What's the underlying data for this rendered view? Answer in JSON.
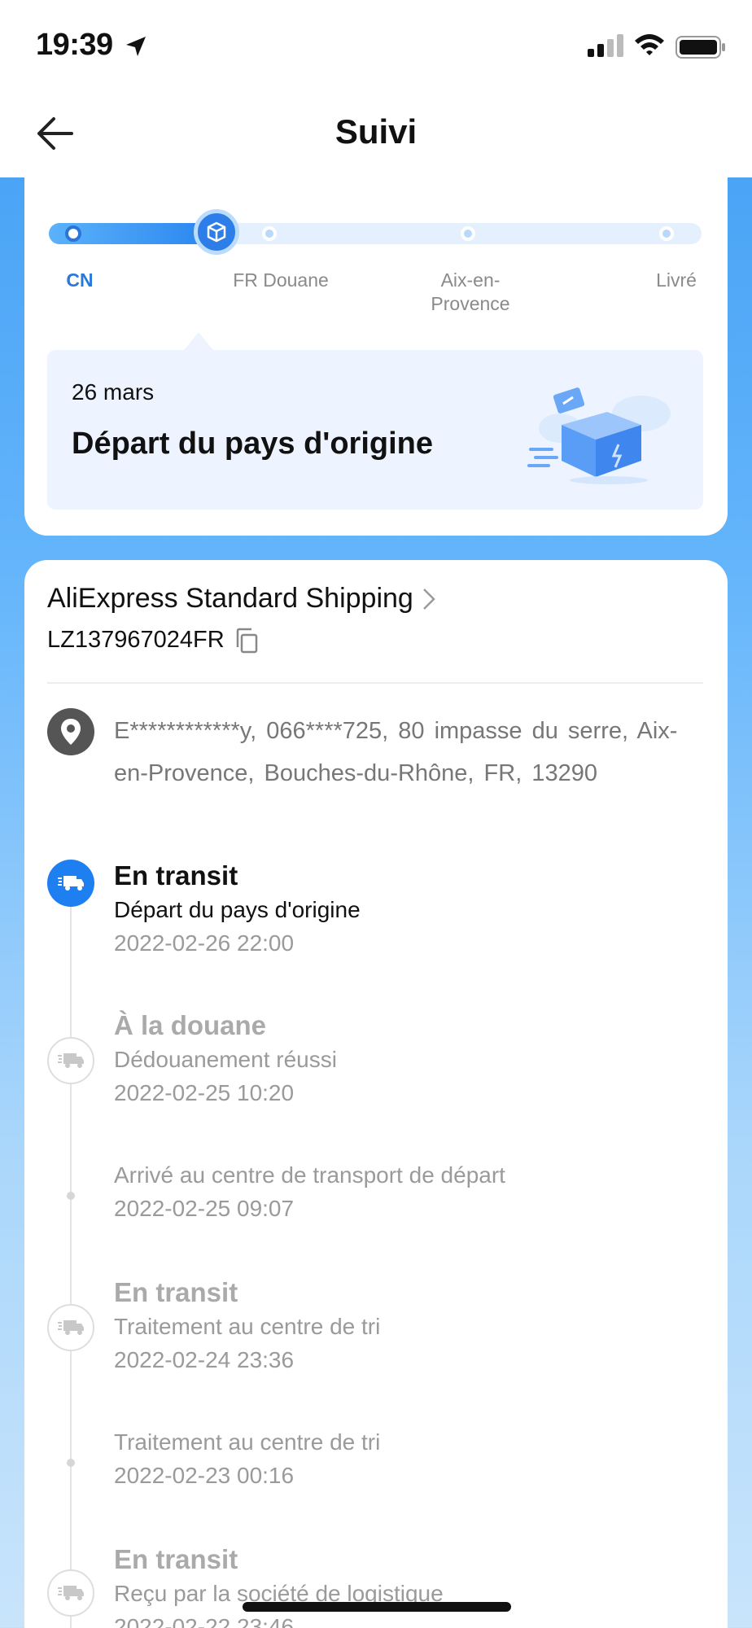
{
  "status_bar": {
    "time": "19:39"
  },
  "header": {
    "title": "Suivi"
  },
  "progress": {
    "stages": [
      "CN",
      "FR Douane",
      "Aix-en-Provence",
      "Livré"
    ],
    "active_stage": 0,
    "current_event": {
      "date": "26 mars",
      "title": "Départ du pays d'origine"
    }
  },
  "shipment": {
    "carrier": "AliExpress Standard Shipping",
    "tracking_number": "LZ137967024FR",
    "address": "E************y,  066****725,  80 impasse du serre,  Aix-en-Provence,  Bouches-du-Rhône,  FR,  13290"
  },
  "events": [
    {
      "status": "En transit",
      "description": "Départ du pays d'origine",
      "time": "2022-02-26 22:00"
    },
    {
      "status": "À la douane",
      "description": "Dédouanement réussi",
      "time": "2022-02-25 10:20"
    },
    {
      "status": "",
      "description": "Arrivé au centre de transport de départ",
      "time": "2022-02-25 09:07"
    },
    {
      "status": "En transit",
      "description": "Traitement au centre de tri",
      "time": "2022-02-24 23:36"
    },
    {
      "status": "",
      "description": "Traitement au centre de tri",
      "time": "2022-02-23 00:16"
    },
    {
      "status": "En transit",
      "description": "Reçu par la société de logistique",
      "time": "2022-02-22 23:46"
    }
  ],
  "colors": {
    "accent": "#1e7ff0",
    "background_top": "#3f9cf3",
    "background_bottom": "#c8e4fb"
  }
}
